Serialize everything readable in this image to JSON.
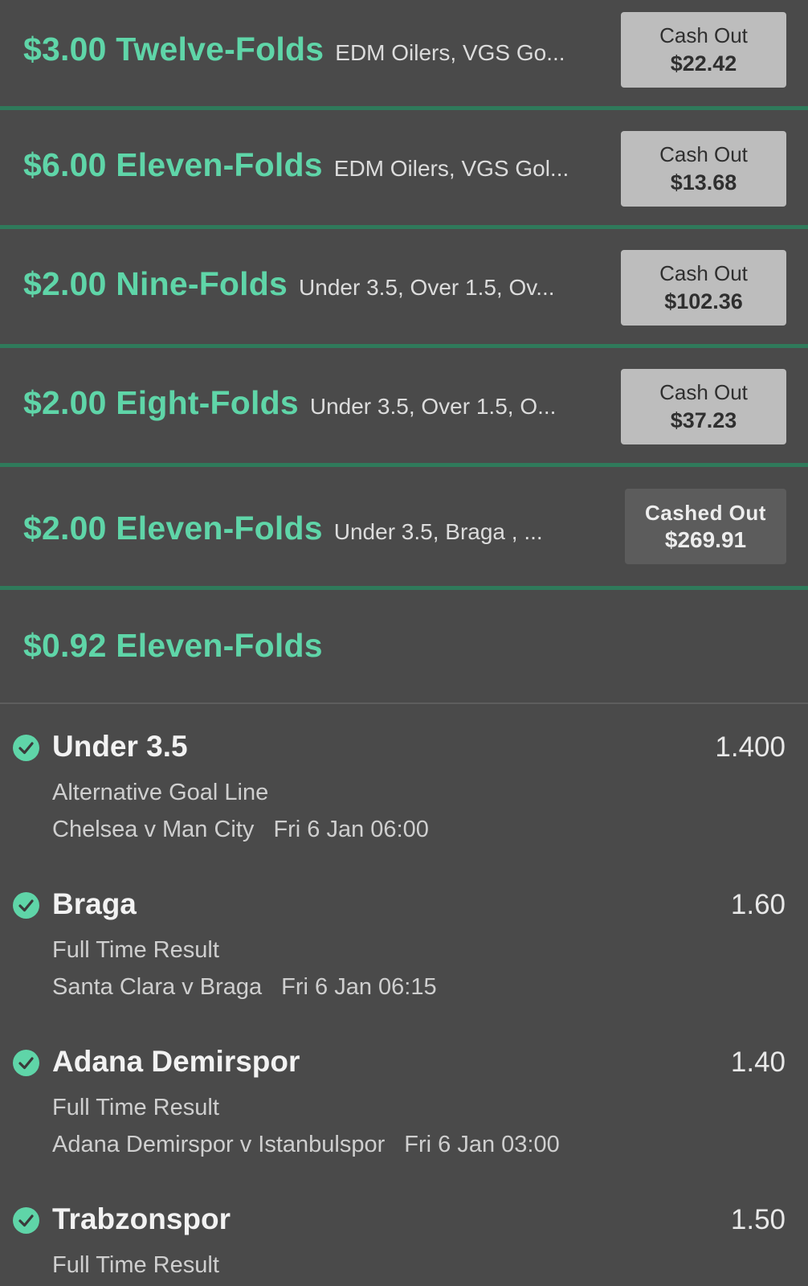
{
  "bets": [
    {
      "amount_type": "$3.00 Twelve-Folds",
      "legs_summary": "EDM Oilers, VGS Go...",
      "button_label": "Cash Out",
      "button_amount": "$22.42"
    },
    {
      "amount_type": "$6.00 Eleven-Folds",
      "legs_summary": "EDM Oilers, VGS Gol...",
      "button_label": "Cash Out",
      "button_amount": "$13.68"
    },
    {
      "amount_type": "$2.00 Nine-Folds",
      "legs_summary": "Under 3.5, Over 1.5, Ov...",
      "button_label": "Cash Out",
      "button_amount": "$102.36"
    },
    {
      "amount_type": "$2.00 Eight-Folds",
      "legs_summary": "Under 3.5, Over 1.5, O...",
      "button_label": "Cash Out",
      "button_amount": "$37.23"
    },
    {
      "amount_type": "$2.00 Eleven-Folds",
      "legs_summary": "Under 3.5, Braga , ...",
      "status_label": "Cashed Out",
      "status_amount": "$269.91"
    }
  ],
  "expanded_bet": {
    "amount_type": "$0.92 Eleven-Folds",
    "legs": [
      {
        "selection": "Under 3.5",
        "odds": "1.400",
        "market": "Alternative Goal Line",
        "event": "Chelsea v Man City",
        "time": "Fri 6 Jan 06:00"
      },
      {
        "selection": "Braga",
        "odds": "1.60",
        "market": "Full Time Result",
        "event": "Santa Clara v Braga",
        "time": "Fri 6 Jan 06:15"
      },
      {
        "selection": "Adana Demirspor",
        "odds": "1.40",
        "market": "Full Time Result",
        "event": "Adana Demirspor v Istanbulspor",
        "time": "Fri 6 Jan 03:00"
      },
      {
        "selection": "Trabzonspor",
        "odds": "1.50",
        "market": "Full Time Result",
        "event": "",
        "time": ""
      }
    ]
  },
  "colors": {
    "background": "#4a4a4a",
    "accent_green": "#5fd5a8",
    "divider_green": "#2f7a5b",
    "button_grey": "#bdbdbd"
  },
  "icons": {
    "leg_status": "check-circle-icon"
  }
}
